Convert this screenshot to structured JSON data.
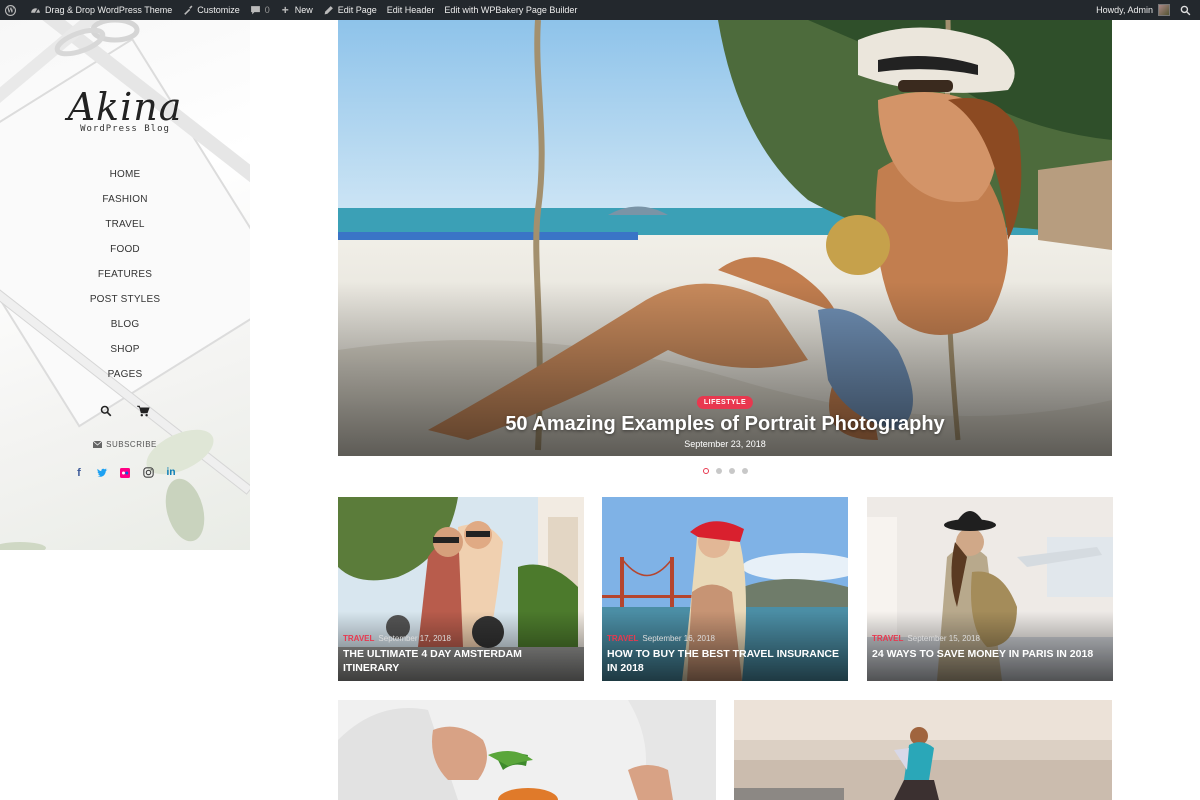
{
  "admin_bar": {
    "site_name": "Drag & Drop WordPress Theme",
    "customize": "Customize",
    "comments_count": "0",
    "new": "New",
    "edit_page": "Edit Page",
    "edit_header": "Edit Header",
    "edit_builder": "Edit with WPBakery Page Builder",
    "greeting": "Howdy, Admin"
  },
  "sidebar": {
    "logo_name": "Akina",
    "logo_tagline": "WordPress Blog",
    "menu": [
      "HOME",
      "FASHION",
      "TRAVEL",
      "FOOD",
      "FEATURES",
      "POST STYLES",
      "BLOG",
      "SHOP",
      "PAGES"
    ],
    "subscribe_label": "SUBSCRIBE",
    "socials": [
      "facebook",
      "twitter",
      "flickr",
      "instagram",
      "linkedin"
    ]
  },
  "hero": {
    "category": "LIFESTYLE",
    "title": "50 Amazing Examples of Portrait Photography",
    "date": "September 23, 2018",
    "slide_count": 4,
    "active_slide": 1
  },
  "cards": [
    {
      "category": "TRAVEL",
      "date": "September 17, 2018",
      "title": "THE ULTIMATE 4 DAY AMSTERDAM ITINERARY"
    },
    {
      "category": "TRAVEL",
      "date": "September 16, 2018",
      "title": "HOW TO BUY THE BEST TRAVEL INSURANCE IN 2018"
    },
    {
      "category": "TRAVEL",
      "date": "September 15, 2018",
      "title": "24 WAYS TO SAVE MONEY IN PARIS IN 2018"
    }
  ],
  "colors": {
    "accent": "#e8384f",
    "admin_bar": "#23282d"
  }
}
